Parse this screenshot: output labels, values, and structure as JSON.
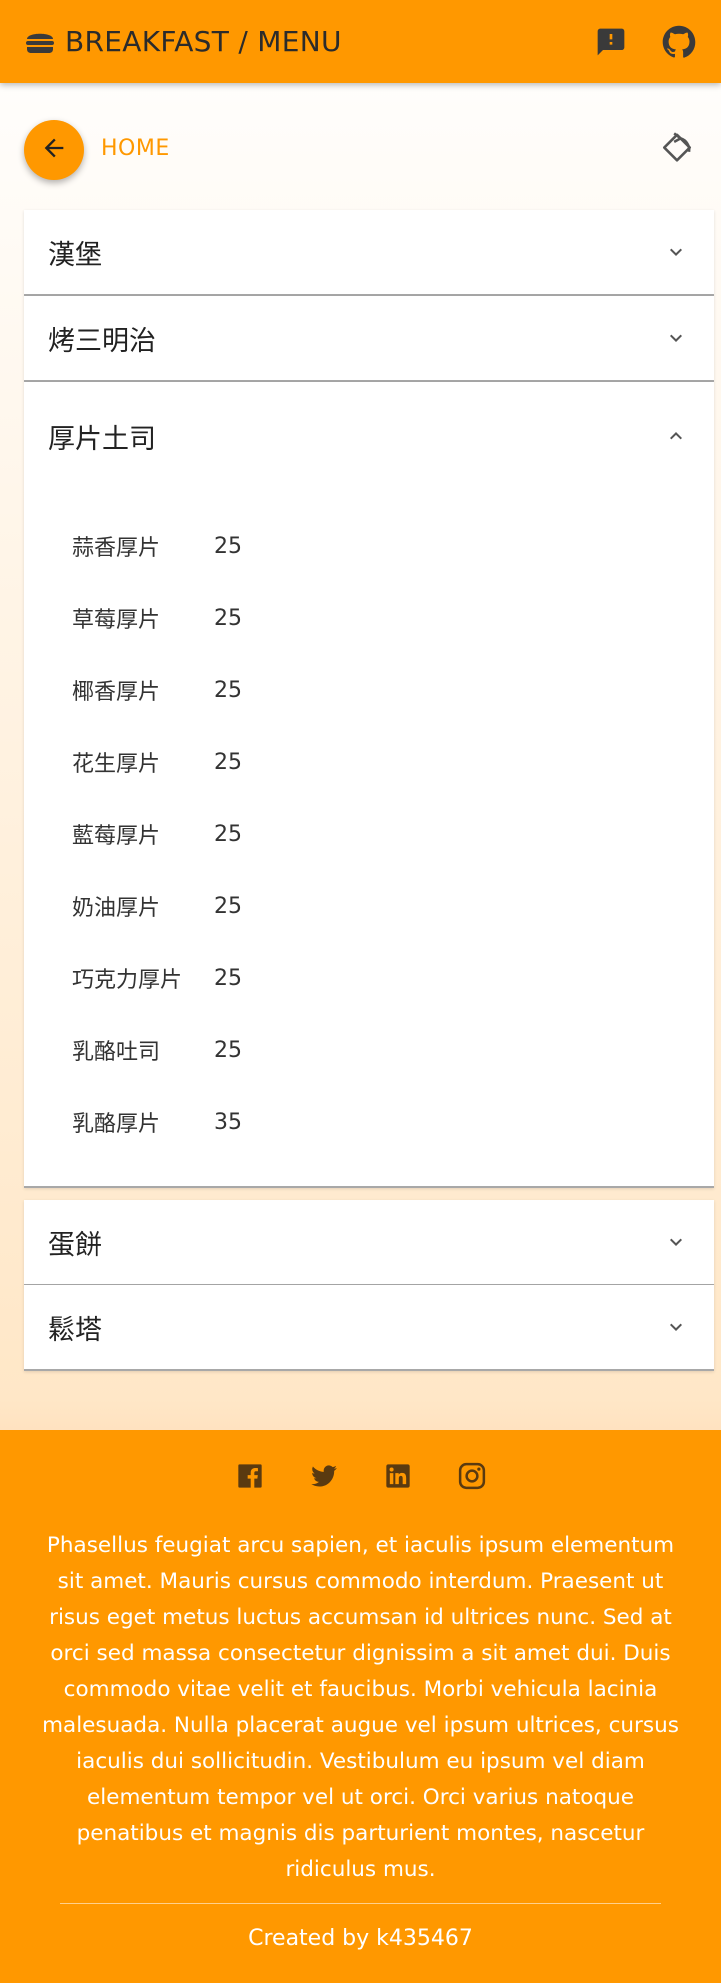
{
  "header": {
    "title": "BREAKFAST / MENU",
    "bar_color": "#ff9800",
    "icons": [
      "burger-icon",
      "feedback-icon",
      "github-icon"
    ]
  },
  "nav": {
    "back_icon": "arrow-left-icon",
    "home_label": "HOME",
    "reset_icon": "rotate-icon"
  },
  "menu": {
    "categories": [
      {
        "label": "漢堡",
        "expanded": false
      },
      {
        "label": "烤三明治",
        "expanded": false
      },
      {
        "label": "厚片土司",
        "expanded": true,
        "items": [
          {
            "name": "蒜香厚片",
            "price": "25"
          },
          {
            "name": "草莓厚片",
            "price": "25"
          },
          {
            "name": "椰香厚片",
            "price": "25"
          },
          {
            "name": "花生厚片",
            "price": "25"
          },
          {
            "name": "藍莓厚片",
            "price": "25"
          },
          {
            "name": "奶油厚片",
            "price": "25"
          },
          {
            "name": "巧克力厚片",
            "price": "25"
          },
          {
            "name": "乳酪吐司",
            "price": "25"
          },
          {
            "name": "乳酪厚片",
            "price": "35"
          }
        ]
      },
      {
        "label": "蛋餅",
        "expanded": false
      },
      {
        "label": "鬆塔",
        "expanded": false
      }
    ]
  },
  "footer": {
    "social_icons": [
      "facebook-icon",
      "twitter-icon",
      "linkedin-icon",
      "instagram-icon"
    ],
    "blurb": "Phasellus feugiat arcu sapien, et iaculis ipsum elementum sit amet. Mauris cursus commodo interdum. Praesent ut risus eget metus luctus accumsan id ultrices nunc. Sed at orci sed massa consectetur dignissim a sit amet dui. Duis commodo vitae velit et faucibus. Morbi vehicula lacinia malesuada. Nulla placerat augue vel ipsum ultrices, cursus iaculis dui sollicitudin. Vestibulum eu ipsum vel diam elementum tempor vel ut orci. Orci varius natoque penatibus et magnis dis parturient montes, nascetur ridiculus mus.",
    "credit": "Created by k435467"
  }
}
